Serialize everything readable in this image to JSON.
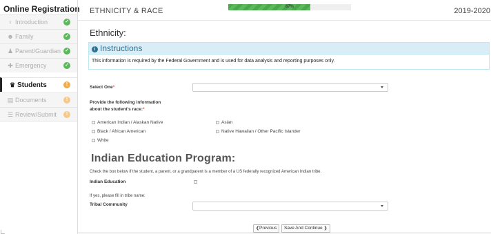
{
  "sidebar": {
    "title": "Online Registration",
    "items": [
      {
        "label": "Introduction",
        "icon": "lightbulb-icon",
        "glyph": "♀",
        "status": "done"
      },
      {
        "label": "Family",
        "icon": "users-icon",
        "glyph": "☻",
        "status": "done"
      },
      {
        "label": "Parent/Guardian",
        "icon": "user-icon",
        "glyph": "♟",
        "status": "done"
      },
      {
        "label": "Emergency",
        "icon": "group-icon",
        "glyph": "✚",
        "status": "done"
      },
      {
        "label": "Students",
        "icon": "graduation-cap-icon",
        "glyph": "♛",
        "status": "warn"
      },
      {
        "label": "Documents",
        "icon": "document-icon",
        "glyph": "▤",
        "status": "warn"
      },
      {
        "label": "Review/Submit",
        "icon": "list-icon",
        "glyph": "☰",
        "status": "warn"
      }
    ],
    "status_glyphs": {
      "done": "✓",
      "warn": "!"
    }
  },
  "header": {
    "section_title": "ETHNICITY & RACE",
    "year": "2019-2020",
    "progress_text": "67%",
    "progress_value": 0.67
  },
  "ethnicity": {
    "heading": "Ethnicity:",
    "instructions_title": "Instructions",
    "instructions_text": "This information is required by the Federal Government and is used for data analysis and reporting purposes only.",
    "select_label": "Select One",
    "select_value": "",
    "race_label_line1": "Provide the following information",
    "race_label_line2": "about the student's race:",
    "required_marker": "*",
    "races": [
      "American Indian / Alaskan Native",
      "Asian",
      "Black / African American",
      "Native Hawaiian / Other Pacific Islander",
      "White"
    ]
  },
  "indian_education": {
    "heading": "Indian Education Program:",
    "description": "Check the box below if the student, a parent, or a grandparent is a member of a US federally recognized American Indian tribe.",
    "checkbox_label": "Indian Education",
    "tribe_prompt": "If yes, please fill in tribe name:",
    "tribal_label": "Tribal Community",
    "tribal_value": ""
  },
  "nav": {
    "previous": "Previous",
    "save_continue": "Save And Continue",
    "prev_glyph": "❮",
    "next_glyph": "❯"
  },
  "colors": {
    "success": "#5cb85c",
    "warning": "#f0ad4e",
    "info_bg": "#d9edf7",
    "info_text": "#31708f",
    "required": "#d9534f"
  }
}
